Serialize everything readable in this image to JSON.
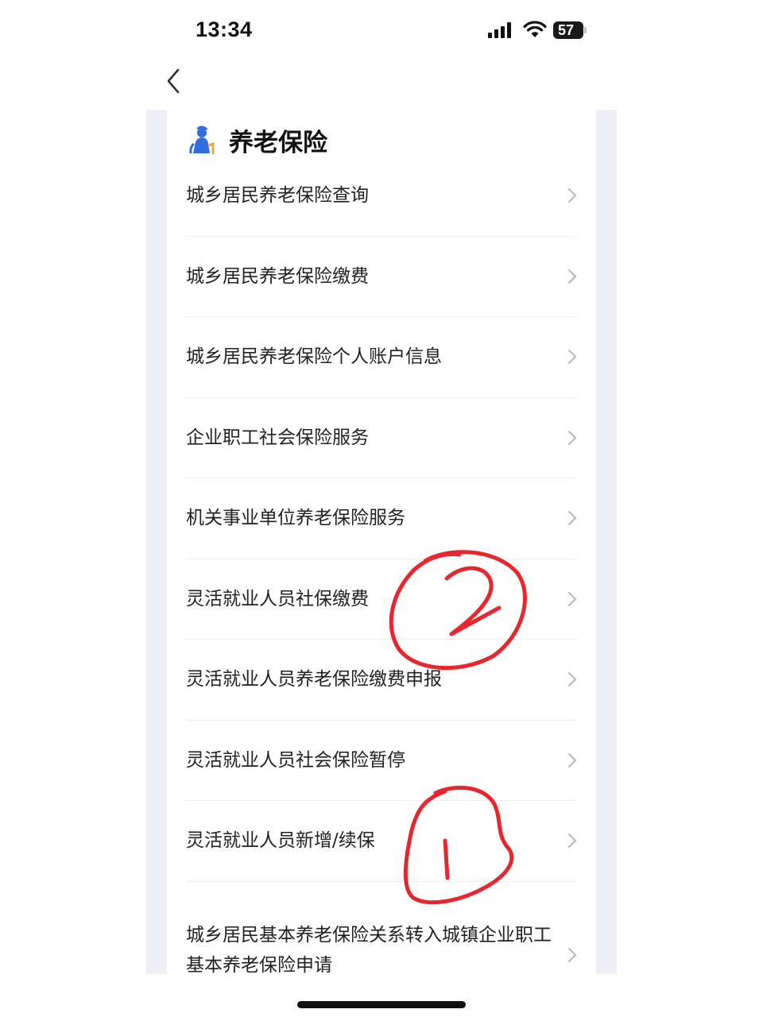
{
  "status_bar": {
    "time": "13:34",
    "battery": "57"
  },
  "section": {
    "title": "养老保险",
    "icon": "elderly-person-icon"
  },
  "menu_items": [
    {
      "label": "城乡居民养老保险查询"
    },
    {
      "label": "城乡居民养老保险缴费"
    },
    {
      "label": "城乡居民养老保险个人账户信息"
    },
    {
      "label": "企业职工社会保险服务"
    },
    {
      "label": "机关事业单位养老保险服务"
    },
    {
      "label": "灵活就业人员社保缴费"
    },
    {
      "label": "灵活就业人员养老保险缴费申报"
    },
    {
      "label": "灵活就业人员社会保险暂停"
    },
    {
      "label": "灵活就业人员新增/续保"
    },
    {
      "label": "城乡居民基本养老保险关系转入城镇企业职工基本养老保险申请"
    }
  ],
  "annotations": {
    "color": "#e8262e",
    "marks": [
      "2",
      "1"
    ]
  },
  "colors": {
    "accent": "#2f6ddc",
    "background_strip": "#eef0f5"
  }
}
